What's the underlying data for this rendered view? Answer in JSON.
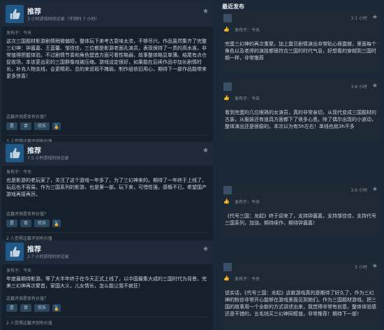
{
  "left_reviews": [
    {
      "title": "推荐",
      "hours": "3 小时游戏时间记录（评测时 7 小时）",
      "date": "发布于：今天",
      "text": "这次三国题材影游剧情稍微偏短，整体玩下来考古意味太浓，不够尽兴。作品虽然集齐了完整三幻神：钟嚣嘉、王蓝馨、邹佳佳，三位都是影游老面孔演员，表现保持了一贯的高水准，非常值得把握体验。不过剧情节奏和角色塑造方面可看性略弱，故事整体略显单薄。结尾有点仓促收场，本该更出彩的三国群像戏被压缩。游戏设定很好，如果能在后续作品中加长剧情时长，补充人物支线，会更精彩。总的来说瑕不掩瑜，制作组依旧用心，期待下一部作品能带来更多惊喜！",
      "help_question": "这篇评测是否有价值？",
      "yes": "是",
      "no": "否",
      "funny": "欢乐",
      "footer": "3 人觉得这篇评测有价值"
    },
    {
      "title": "推荐",
      "hours": "7.5 小时游戏时间记录",
      "date": "发布于：今天",
      "text": "也是影游的老玩家了，关注了这个游戏一年多了，为了三幻神来的。期待了一年终于上线了，玩后也不容易。作为三国系列的影游，也是第一部。玩下来，可惜性强，感慨不已。希望国产游戏再接再厉。",
      "help_question": "这篇评测是否有价值？",
      "yes": "是",
      "no": "否",
      "funny": "欢乐",
      "footer": "2 人觉得这篇评测有价值"
    },
    {
      "title": "推荐",
      "hours": "2.7 小时游戏时间记录",
      "date": "发布于：今天",
      "text": "年度最期待影游。等了大半年终于在今天正式上线了，以中国最集大成的三国时代为背景，完美三幻神再次聚首，家国大义，儿女情长，怎么能让我不疯狂！",
      "help_question": "这篇评测是否有价值？",
      "yes": "是",
      "no": "否",
      "funny": "欢乐",
      "footer": "2 人觉得这篇评测有价值"
    }
  ],
  "right_panel": {
    "title": "最近发布",
    "cards": [
      {
        "time": "3.1 小时",
        "date": "发布于：今天",
        "text": "完蛋三幻神的再次重聚，加上震旦剧情演出非常贴心很震撼，里面每个角色以及老师的演技都很符合三国的时代气息，好想看的穿越到三国时期一样，非常推荐"
      },
      {
        "time": "3.6 小时",
        "date": "发布于：今天",
        "text": "看到完蛋的几位眼熟的女演员，真的非常亲切，从现代变成三国题材的古装，从服装还有道具方面都下了很多心思。除了偶尔出现的小波动，整体演出还是很稳的。本次以为有5h左右！单线也就3h不多"
      },
      {
        "time": "3.6 小时",
        "date": "发布于：今天",
        "text": "《代号三国：龙起》终于迎来了，支持钟嚣嘉，支持邹佳佳，支持代号三国系列，加油，期待续作，期待钟嚣嘉！"
      },
      {
        "time": "5 小时",
        "date": "发布于：今天",
        "text": "说实话，《代号三国：龙起》这款游戏真的是期待了好久了，作为三幻神的粉丝非常开心能够在游戏里面见到她们。作为三国题材游戏，把三国的故事用一个全新的方式讲述出来，我觉得非常有创意。整体体验感还是不错的，五毛钱买三幻神同框值，非常推荐！期待下一部！"
      }
    ]
  },
  "colors": {
    "background": "#1b2838",
    "card": "#1e2936",
    "accent": "#66c0f4"
  }
}
